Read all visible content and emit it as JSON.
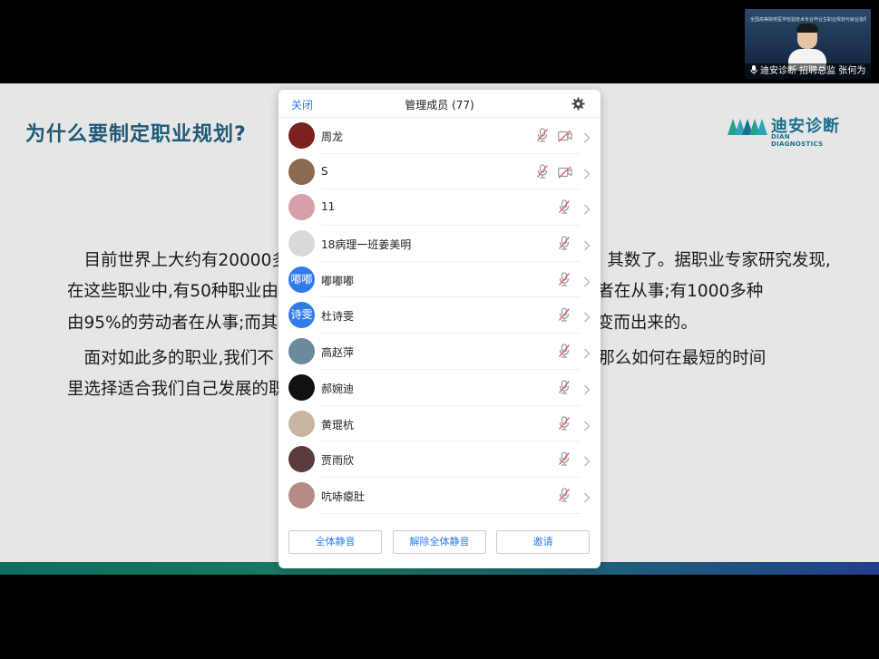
{
  "slide": {
    "title": "为什么要制定职业规划?",
    "logo": {
      "name": "迪安诊断",
      "sub": "DIAN DIAGNOSTICS"
    },
    "paragraphs": {
      "p1": "　目前世界上大约有20000多　　　　　　　　　　　　　　　　　　　其数了。据职业专家研究发现,",
      "p2": "在这些职业中,有50种职业由　　　　　　　　　　　　　　　　的劳动者在从事;有1000多种",
      "p3": "由95%的劳动者在从事;而其　　　　　　　　　　　　　　　　发生演变而出来的。",
      "p4": "　面对如此多的职业,我们不　　　　　　　　　　　　　　　　一尝试,那么如何在最短的时间",
      "p5": "里选择适合我们自己发展的职"
    },
    "colors": {
      "title": "#1d5a78",
      "logo": "#1b6f8c"
    }
  },
  "video": {
    "banner": "全国高等院校医学检验技术专业毕业生职业规划与就业指导",
    "speaker_label": "迪安诊断 招聘总监 张何为"
  },
  "dialog": {
    "close_label": "关闭",
    "title": "管理成员 (77)",
    "members": [
      {
        "name": "周龙",
        "avatar_text": "",
        "avatar_color": "#7a2020",
        "mic_muted": true,
        "cam": true
      },
      {
        "name": "S",
        "avatar_text": "",
        "avatar_color": "#8a6a50",
        "mic_muted": true,
        "cam": true
      },
      {
        "name": "11",
        "avatar_text": "",
        "avatar_color": "#d7a0a8",
        "mic_muted": true,
        "cam": false
      },
      {
        "name": "18病理一班姜美明",
        "avatar_text": "",
        "avatar_color": "#d9d9d9",
        "mic_muted": true,
        "cam": false
      },
      {
        "name": "嘟嘟嘟",
        "avatar_text": "嘟嘟",
        "avatar_color": "#2f7bea",
        "mic_muted": true,
        "cam": false
      },
      {
        "name": "杜诗雯",
        "avatar_text": "诗雯",
        "avatar_color": "#2f7bea",
        "mic_muted": true,
        "cam": false
      },
      {
        "name": "高赵萍",
        "avatar_text": "",
        "avatar_color": "#6d8a9a",
        "mic_muted": true,
        "cam": false
      },
      {
        "name": "郝婉迪",
        "avatar_text": "",
        "avatar_color": "#111111",
        "mic_muted": true,
        "cam": false
      },
      {
        "name": "黄琨杭",
        "avatar_text": "",
        "avatar_color": "#c9b6a2",
        "mic_muted": true,
        "cam": false
      },
      {
        "name": "贾雨欣",
        "avatar_text": "",
        "avatar_color": "#5a3a3a",
        "mic_muted": true,
        "cam": false
      },
      {
        "name": "吭哧瘪肚",
        "avatar_text": "",
        "avatar_color": "#b58b86",
        "mic_muted": true,
        "cam": false
      }
    ],
    "buttons": {
      "mute_all": "全体静音",
      "unmute_all": "解除全体静音",
      "invite": "邀请"
    },
    "colors": {
      "accent": "#2f7bea",
      "muted_icon": "#e25a5a"
    }
  }
}
